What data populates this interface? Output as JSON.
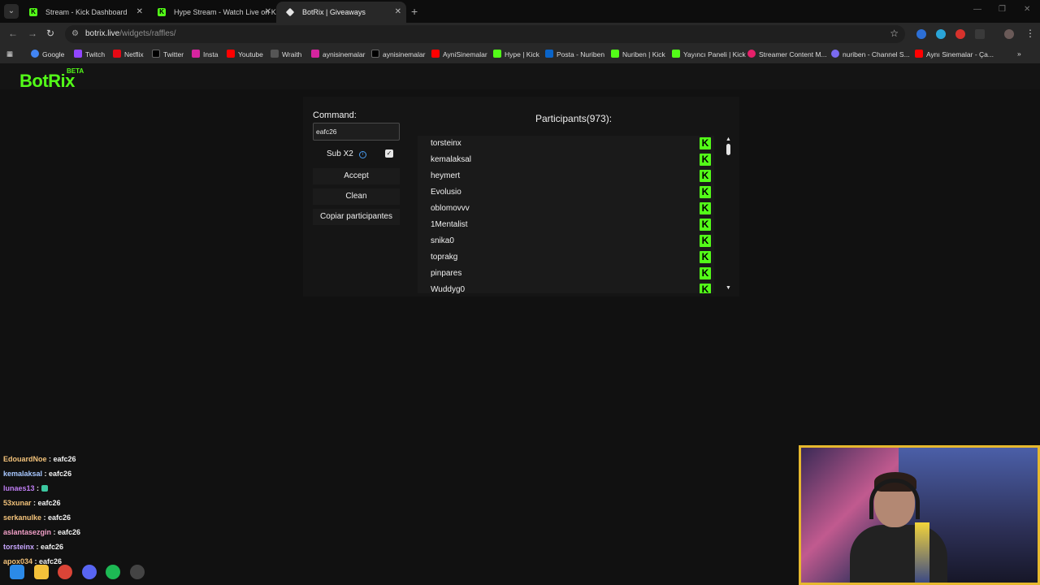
{
  "browser": {
    "tabs": [
      {
        "title": "Stream - Kick Dashboard",
        "active": false
      },
      {
        "title": "Hype Stream - Watch Live on K",
        "active": false
      },
      {
        "title": "BotRix | Giveaways",
        "active": true
      }
    ],
    "url_host": "botrix.live",
    "url_path": "/widgets/raffles/",
    "bookmarks": [
      "Google",
      "Twitch",
      "Netflix",
      "Twitter",
      "Insta",
      "Youtube",
      "Wraith",
      "aynisinemalar",
      "aynisinemalar",
      "AyniSinemalar",
      "Hype | Kick",
      "Posta - Nuriben",
      "Nuriben | Kick",
      "Yayıncı Paneli | Kick",
      "Streamer Content M...",
      "nuriben - Channel S...",
      "Aynı Sinemalar - Ça..."
    ]
  },
  "app": {
    "logo": "BotRix",
    "badge": "BETA"
  },
  "raffle": {
    "command_label": "Command:",
    "command_value": "eafc26",
    "sub_label": "Sub X2",
    "sub_checked": true,
    "accept_label": "Accept",
    "clean_label": "Clean",
    "copy_label": "Copiar participantes",
    "participants_title": "Participants(973):",
    "participants": [
      "torsteinx",
      "kemalaksal",
      "heymert",
      "Evolusio",
      "oblomovvv",
      "1Mentalist",
      "snika0",
      "toprakg",
      "pinpares",
      "Wuddyg0"
    ]
  },
  "chat": [
    {
      "user": "EdouardNoe",
      "color": "#f2c27a",
      "msg": "eafc26"
    },
    {
      "user": "kemalaksal",
      "color": "#a8c8ff",
      "msg": "eafc26"
    },
    {
      "user": "lunaes13",
      "color": "#c07ef5",
      "msg": "",
      "emote": true
    },
    {
      "user": "53xunar",
      "color": "#f2c27a",
      "msg": "eafc26"
    },
    {
      "user": "serkanulke",
      "color": "#f2c27a",
      "msg": "eafc26"
    },
    {
      "user": "aslantasezgin",
      "color": "#f2a0c8",
      "msg": "eafc26"
    },
    {
      "user": "torsteinx",
      "color": "#c8a6ff",
      "msg": "eafc26"
    },
    {
      "user": "apox034",
      "color": "#f2c27a",
      "msg": "eafc26"
    }
  ],
  "colors": {
    "kick_green": "#53fc18",
    "webcam_border": "#e6b82e"
  }
}
